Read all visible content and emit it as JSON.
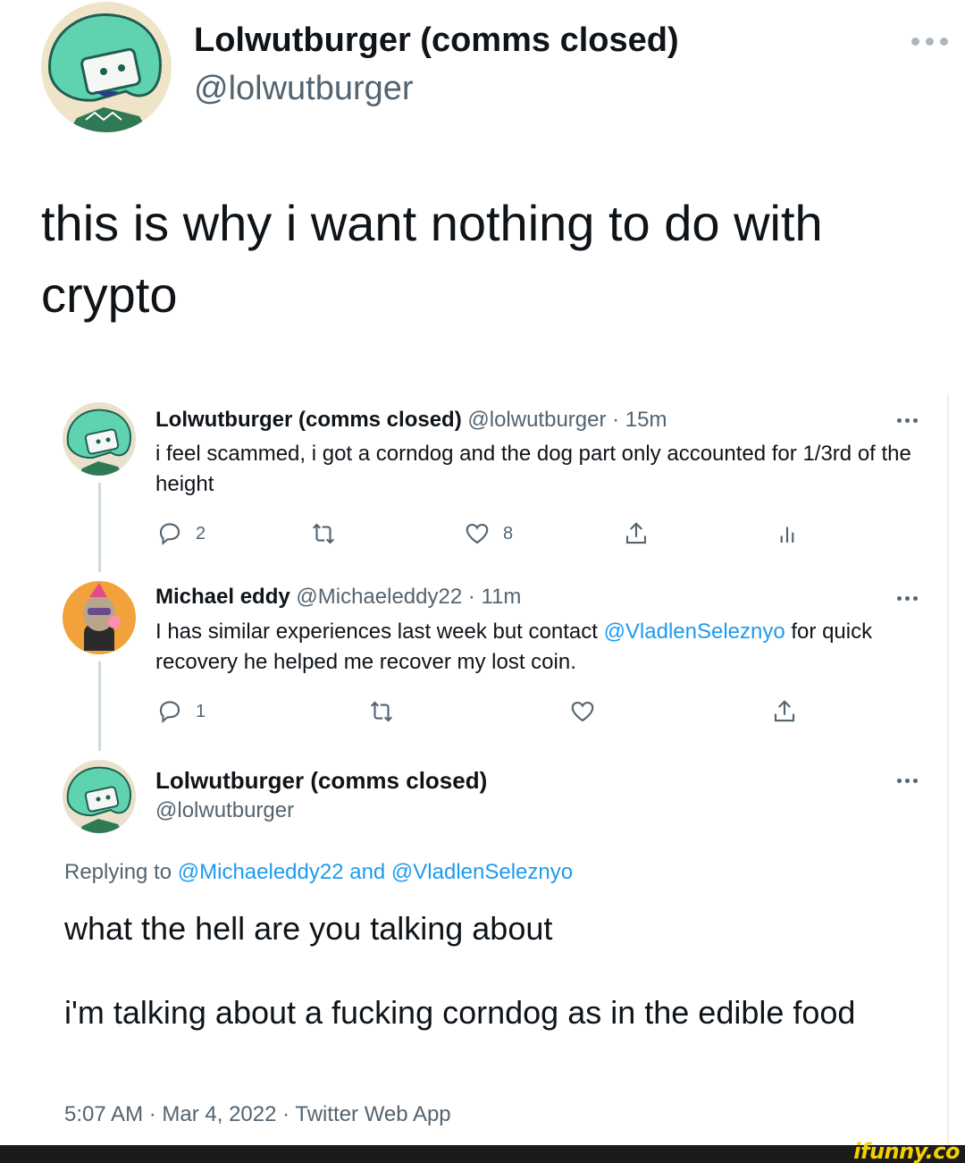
{
  "top_tweet": {
    "name": "Lolwutburger (comms closed)",
    "handle": "@lolwutburger",
    "text": "this is why i want nothing to do with crypto",
    "more_icon": "more-dots-icon"
  },
  "thread": {
    "tweet1": {
      "name": "Lolwutburger (comms closed)",
      "handle_time": "@lolwutburger · 15m",
      "text": "i feel scammed, i got a corndog and the dog part only accounted for 1/3rd of the height",
      "replies": "2",
      "likes": "8"
    },
    "tweet2": {
      "name": "Michael eddy",
      "handle_time": "@Michaeleddy22 · 11m",
      "text_before": "I has similar experiences last week but contact ",
      "mention": "@VladlenSeleznyo",
      "text_after": " for quick recovery he helped me recover my lost coin.",
      "replies": "1"
    },
    "main": {
      "name": "Lolwutburger (comms closed)",
      "handle": "@lolwutburger",
      "replying_prefix": "Replying to ",
      "replying_targets": "@Michaeleddy22 and @VladlenSeleznyo",
      "text1": "what the hell are you talking about",
      "text2": "i'm talking about a fucking corndog as in the edible food",
      "meta": "5:07 AM · Mar 4, 2022 · Twitter Web App"
    }
  },
  "watermark": "ifunny.co",
  "colors": {
    "link": "#1d9bf0",
    "secondary": "#536471",
    "avatar_teal": "#5fd3b0",
    "watermark": "#f5d000"
  }
}
